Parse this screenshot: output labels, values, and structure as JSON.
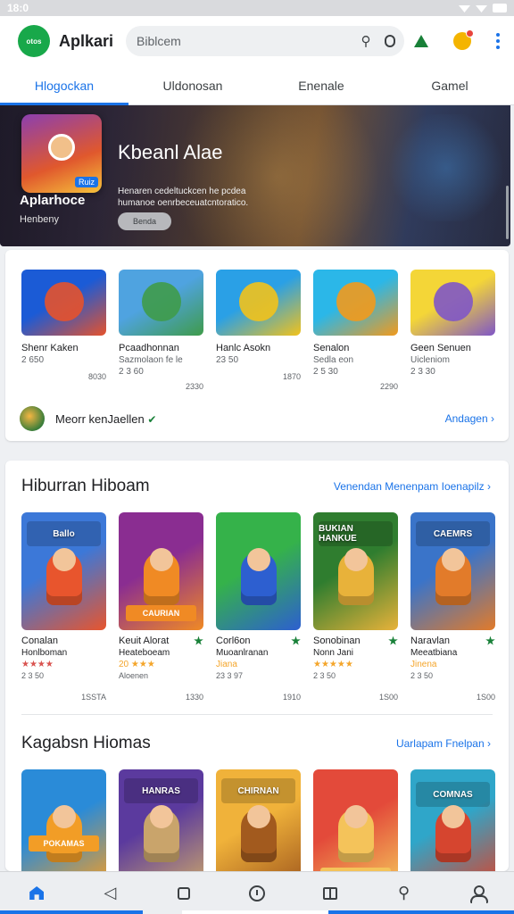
{
  "status": {
    "time": "18:0"
  },
  "app_bar": {
    "logo_text": "otos",
    "title": "Aplkari",
    "search_placeholder": "Biblcem"
  },
  "tabs": [
    {
      "label": "Hlogockan",
      "active": true
    },
    {
      "label": "Uldonosan",
      "active": false
    },
    {
      "label": "Enenale",
      "active": false
    },
    {
      "label": "Gamel",
      "active": false
    }
  ],
  "hero": {
    "badge_chip": "Ruiz",
    "title": "Kbeanl Alae",
    "app_name": "Aplarhoce",
    "sub": "Henbeny",
    "desc_line1": "Henaren cedeltuckcen he pcdea",
    "desc_line2": "humanoe oenrbeceuatcntoratico.",
    "button": "Benda"
  },
  "row1": [
    {
      "name": "Shenr Kaken",
      "meta": "2 650",
      "meta2": "",
      "price": "8030",
      "colors": [
        "#1b5bd6",
        "#e6522c"
      ]
    },
    {
      "name": "Pcaadhonnan",
      "meta": "Sazmolaon fe le",
      "meta2": "2 3 60",
      "price": "2330",
      "colors": [
        "#4fa3e0",
        "#3f9b4a"
      ]
    },
    {
      "name": "Hanlc Asokn",
      "meta": "23 50",
      "meta2": "",
      "price": "1870",
      "colors": [
        "#2aa0e6",
        "#f2c21b"
      ]
    },
    {
      "name": "Senalon",
      "meta": "Sedla eon",
      "meta2": "2 5 30",
      "price": "2290",
      "colors": [
        "#2bb7e8",
        "#f29a1c"
      ]
    },
    {
      "name": "Geen Senuen",
      "meta": "Uicleniom",
      "meta2": "2 3 30",
      "price": "",
      "colors": [
        "#f4d637",
        "#7f56c7"
      ]
    }
  ],
  "promo": {
    "text": "Meorr kenJaellen",
    "link": "Andagen"
  },
  "section1": {
    "title": "Hiburran Hiboam",
    "link": "Venendan Menenpam Ioenapilz"
  },
  "row2": [
    {
      "strip": "Ballo",
      "low": "",
      "name": "Conalan",
      "sub": "Honlboman",
      "stars": "★★★★",
      "stars_red": true,
      "meta": "2 3 50",
      "price": "1SSTA",
      "colors": [
        "#3c78d8",
        "#e8552d"
      ]
    },
    {
      "strip": "",
      "low": "CAURIAN",
      "name": "Keuit Alorat",
      "sub": "Heateboeam",
      "stars": "20 ★★★",
      "stars_red": false,
      "meta": "Aloenen",
      "price": "1330",
      "colors": [
        "#8a2d91",
        "#f08a24"
      ]
    },
    {
      "strip": "",
      "low": "",
      "name": "Corl6on",
      "sub": "Muoanlranan",
      "stars": "Jiana",
      "stars_red": false,
      "meta": "23 3 97",
      "price": "1910",
      "colors": [
        "#35b24a",
        "#2d5fd0"
      ]
    },
    {
      "strip": "BUKIAN HANKUE",
      "low": "",
      "name": "Sonobinan",
      "sub": "Nonn Jani",
      "stars": "★★★★★",
      "stars_red": false,
      "meta": "2 3 50",
      "price": "1S00",
      "colors": [
        "#2f7d2f",
        "#e8b23a"
      ]
    },
    {
      "strip": "CAEMRS",
      "low": "",
      "name": "Naravlan",
      "sub": "Meeatbiana",
      "stars": "Jinena",
      "stars_red": false,
      "meta": "2 3 50",
      "price": "1S00",
      "colors": [
        "#3a74c9",
        "#e27b2a"
      ]
    }
  ],
  "section2": {
    "title": "Kagabsn Hiomas",
    "link": "Uarlapam Fnelpan"
  },
  "row3": [
    {
      "strip": "",
      "low": "POKAMAS",
      "colors": [
        "#2a8bd8",
        "#f29d26"
      ]
    },
    {
      "strip": "HANRAS",
      "low": "",
      "colors": [
        "#5b3a9e",
        "#c9a46b"
      ]
    },
    {
      "strip": "CHIRNAN",
      "low": "",
      "colors": [
        "#f0b23a",
        "#a25a1e"
      ]
    },
    {
      "strip": "",
      "low": "Cuenoll",
      "colors": [
        "#e34a3a",
        "#f4c35a"
      ]
    },
    {
      "strip": "COMNAS",
      "low": "",
      "colors": [
        "#2fa6c9",
        "#d6452f"
      ]
    }
  ]
}
